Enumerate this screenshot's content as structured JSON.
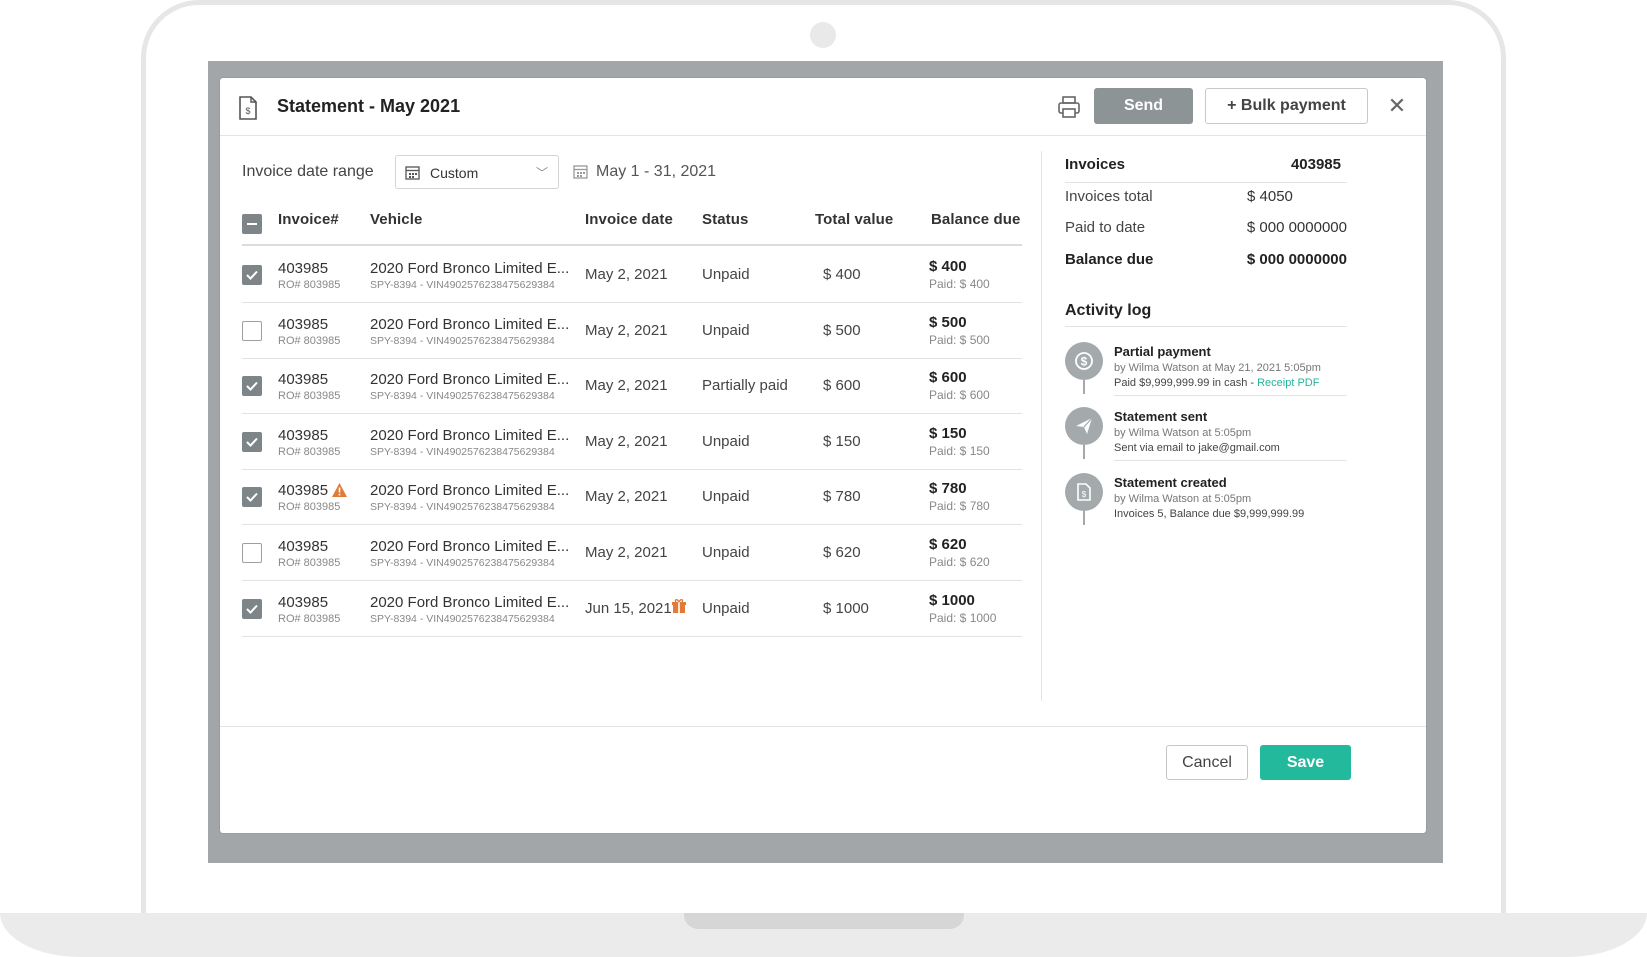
{
  "modal": {
    "title": "Statement - May 2021",
    "send_label": "Send",
    "bulk_payment_label": "+ Bulk payment"
  },
  "filter": {
    "range_label": "Invoice date range",
    "range_value": "Custom",
    "date_range": "May 1 - 31, 2021"
  },
  "table": {
    "headers": {
      "invoice": "Invoice#",
      "vehicle": "Vehicle",
      "invoice_date": "Invoice date",
      "status": "Status",
      "total_value": "Total value",
      "balance_due": "Balance due"
    },
    "rows": [
      {
        "checked": true,
        "invoice": "403985",
        "ro": "RO# 803985",
        "vehicle": "2020 Ford Bronco Limited E...",
        "vin": "SPY-8394 - VIN490257623847562938​4",
        "date": "May 2, 2021",
        "status": "Unpaid",
        "total": "$ 400",
        "balance": "$ 400",
        "paid": "Paid: $ 400",
        "warning": false,
        "gift": false
      },
      {
        "checked": false,
        "invoice": "403985",
        "ro": "RO# 803985",
        "vehicle": "2020 Ford Bronco Limited E...",
        "vin": "SPY-8394 - VIN4902576238475629384",
        "date": "May 2, 2021",
        "status": "Unpaid",
        "total": "$ 500",
        "balance": "$ 500",
        "paid": "Paid: $ 500",
        "warning": false,
        "gift": false
      },
      {
        "checked": true,
        "invoice": "403985",
        "ro": "RO# 803985",
        "vehicle": "2020 Ford Bronco Limited E...",
        "vin": "SPY-8394 - VIN4902576238475629384",
        "date": "May 2, 2021",
        "status": "Partially paid",
        "total": "$ 600",
        "balance": "$ 600",
        "paid": "Paid: $ 600",
        "warning": false,
        "gift": false
      },
      {
        "checked": true,
        "invoice": "403985",
        "ro": "RO# 803985",
        "vehicle": "2020 Ford Bronco Limited E...",
        "vin": "SPY-8394 - VIN4902576238475629384",
        "date": "May 2, 2021",
        "status": "Unpaid",
        "total": "$ 150",
        "balance": "$ 150",
        "paid": "Paid: $ 150",
        "warning": false,
        "gift": false
      },
      {
        "checked": true,
        "invoice": "403985",
        "ro": "RO# 803985",
        "vehicle": "2020 Ford Bronco Limited E...",
        "vin": "SPY-8394 - VIN4902576238475629384",
        "date": "May 2, 2021",
        "status": "Unpaid",
        "total": "$ 780",
        "balance": "$ 780",
        "paid": "Paid: $ 780",
        "warning": true,
        "gift": false
      },
      {
        "checked": false,
        "invoice": "403985",
        "ro": "RO# 803985",
        "vehicle": "2020 Ford Bronco Limited E...",
        "vin": "SPY-8394 - VIN4902576238475629384",
        "date": "May 2, 2021",
        "status": "Unpaid",
        "total": "$ 620",
        "balance": "$ 620",
        "paid": "Paid: $ 620",
        "warning": false,
        "gift": false
      },
      {
        "checked": true,
        "invoice": "403985",
        "ro": "RO# 803985",
        "vehicle": "2020 Ford Bronco Limited E...",
        "vin": "SPY-8394 - VIN4902576238475629384",
        "date": "Jun 15, 2021",
        "status": "Unpaid",
        "total": "$ 1000",
        "balance": "$ 1000",
        "paid": "Paid: $ 1000",
        "warning": false,
        "gift": true
      }
    ]
  },
  "summary": {
    "invoices_label": "Invoices",
    "invoices_value": "403985",
    "invoices_total_label": "Invoices total",
    "invoices_total_value": "$ 4050",
    "paid_to_date_label": "Paid to date",
    "paid_to_date_value": "$ 000 0000000",
    "balance_due_label": "Balance due",
    "balance_due_value": "$ 000 0000000"
  },
  "activity_log": {
    "title": "Activity log",
    "items": [
      {
        "icon": "dollar-icon",
        "title": "Partial payment",
        "line1": "by Wilma Watson at May 21, 2021 5:05pm",
        "line2": "Paid $9,999,999.99 in cash - ",
        "link": "Receipt PDF"
      },
      {
        "icon": "send-icon",
        "title": "Statement sent",
        "line1": "by Wilma Watson at 5:05pm",
        "line2": "Sent via email to jake@gmail.com",
        "link": ""
      },
      {
        "icon": "document-icon",
        "title": "Statement created",
        "line1": "by Wilma Watson at 5:05pm",
        "line2": "Invoices 5, Balance due $9,999,999.99",
        "link": ""
      }
    ]
  },
  "footer": {
    "cancel_label": "Cancel",
    "save_label": "Save"
  },
  "colors": {
    "accent": "#22b99d",
    "send_button": "#8c9496",
    "warning": "#e07b39",
    "link": "#23b59a"
  }
}
